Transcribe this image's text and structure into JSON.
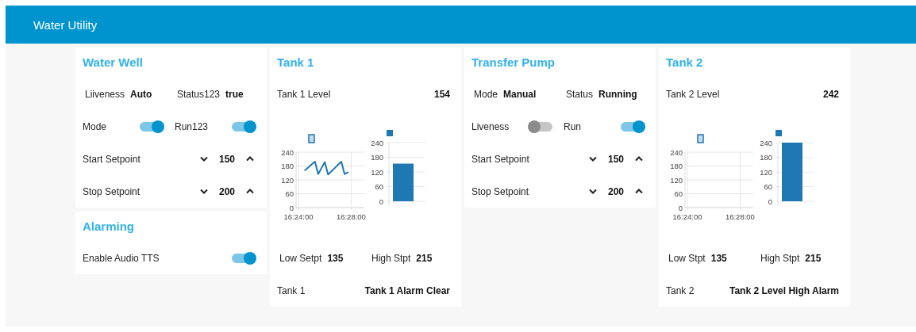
{
  "header": {
    "title": "Water Utility"
  },
  "columns": [
    {
      "cards": [
        {
          "title": "Water Well",
          "rows": [
            {
              "kind": "texts",
              "items": [
                {
                  "label": "Liiveness",
                  "value": "Auto"
                },
                {
                  "label": "Status123",
                  "value": "true"
                }
              ]
            },
            {
              "kind": "switches",
              "items": [
                {
                  "label": "Mode",
                  "on": true
                },
                {
                  "label": "Run123",
                  "on": true
                }
              ]
            },
            {
              "kind": "stepper",
              "label": "Start Setpoint",
              "value": "150"
            },
            {
              "kind": "stepper",
              "label": "Stop Setpoint",
              "value": "200"
            }
          ]
        },
        {
          "title": "Alarming",
          "rows": [
            {
              "kind": "switch",
              "label": "Enable Audio TTS",
              "on": true
            }
          ]
        }
      ]
    },
    {
      "cards": [
        {
          "title": "Tank 1",
          "rows": [
            {
              "kind": "value",
              "label": "Tank 1 Level",
              "value": "154"
            },
            {
              "kind": "charts",
              "charts": [
                {
                  "chart_data": {
                    "type": "line",
                    "grid": true,
                    "ylim": [
                      0,
                      240
                    ],
                    "yticks": [
                      0,
                      60,
                      120,
                      180,
                      240
                    ],
                    "categories": [
                      "16:24:00",
                      null,
                      null,
                      null,
                      null,
                      null,
                      null,
                      null,
                      null,
                      null,
                      null,
                      null,
                      null,
                      null,
                      null,
                      null,
                      "16:28:00",
                      null,
                      null,
                      null,
                      null
                    ],
                    "series": [
                      {
                        "color": "#1f77b4",
                        "values": [
                          null,
                          null,
                          162,
                          174,
                          187,
                          199,
                          145,
                          171,
                          197,
                          143,
                          157,
                          171,
                          185,
                          199,
                          145,
                          152,
                          null,
                          null,
                          null,
                          null,
                          null
                        ]
                      }
                    ]
                  }
                },
                {
                  "chart_data": {
                    "type": "bar",
                    "grid": true,
                    "ylim": [
                      0,
                      240
                    ],
                    "yticks": [
                      0,
                      60,
                      120,
                      180,
                      240
                    ],
                    "series": [
                      {
                        "color": "#1f77b4",
                        "values": [
                          154
                        ]
                      }
                    ]
                  }
                }
              ]
            },
            {
              "kind": "texts",
              "items": [
                {
                  "label": "Low Setpt",
                  "value": "135"
                },
                {
                  "label": "High Stpt",
                  "value": "215"
                }
              ]
            },
            {
              "kind": "value",
              "label": "Tank 1",
              "value": "Tank 1 Alarm Clear"
            }
          ]
        }
      ]
    },
    {
      "cards": [
        {
          "title": "Transfer Pump",
          "rows": [
            {
              "kind": "texts",
              "items": [
                {
                  "label": "Mode",
                  "value": "Manual"
                },
                {
                  "label": "Status",
                  "value": "Running"
                }
              ]
            },
            {
              "kind": "switches",
              "items": [
                {
                  "label": "Liveness",
                  "on": false
                },
                {
                  "label": "Run",
                  "on": true
                }
              ]
            },
            {
              "kind": "stepper",
              "label": "Start Setpoint",
              "value": "150"
            },
            {
              "kind": "stepper",
              "label": "Stop Setpoint",
              "value": "200"
            }
          ]
        }
      ]
    },
    {
      "cards": [
        {
          "title": "Tank 2",
          "rows": [
            {
              "kind": "value",
              "label": "Tank 2 Level",
              "value": "242"
            },
            {
              "kind": "charts",
              "charts": [
                {
                  "chart_data": {
                    "type": "line",
                    "grid": true,
                    "ylim": [
                      0,
                      240
                    ],
                    "yticks": [
                      0,
                      60,
                      120,
                      180,
                      240
                    ],
                    "categories": [
                      "16:24:00",
                      null,
                      null,
                      null,
                      null,
                      null,
                      null,
                      null,
                      null,
                      null,
                      null,
                      null,
                      null,
                      null,
                      null,
                      null,
                      "16:28:00",
                      null,
                      null,
                      null,
                      null
                    ]
                  }
                },
                {
                  "chart_data": {
                    "type": "bar",
                    "grid": true,
                    "ylim": [
                      0,
                      242
                    ],
                    "yticks": [
                      0,
                      60,
                      120,
                      180,
                      240
                    ],
                    "series": [
                      {
                        "color": "#1f77b4",
                        "values": [
                          242
                        ]
                      }
                    ]
                  }
                }
              ]
            },
            {
              "kind": "texts",
              "items": [
                {
                  "label": "Low Stpt",
                  "value": "135"
                },
                {
                  "label": "High Stpt",
                  "value": "215"
                }
              ]
            },
            {
              "kind": "value",
              "label": "Tank 2",
              "value": "Tank 2 Level High Alarm"
            }
          ]
        }
      ]
    }
  ]
}
